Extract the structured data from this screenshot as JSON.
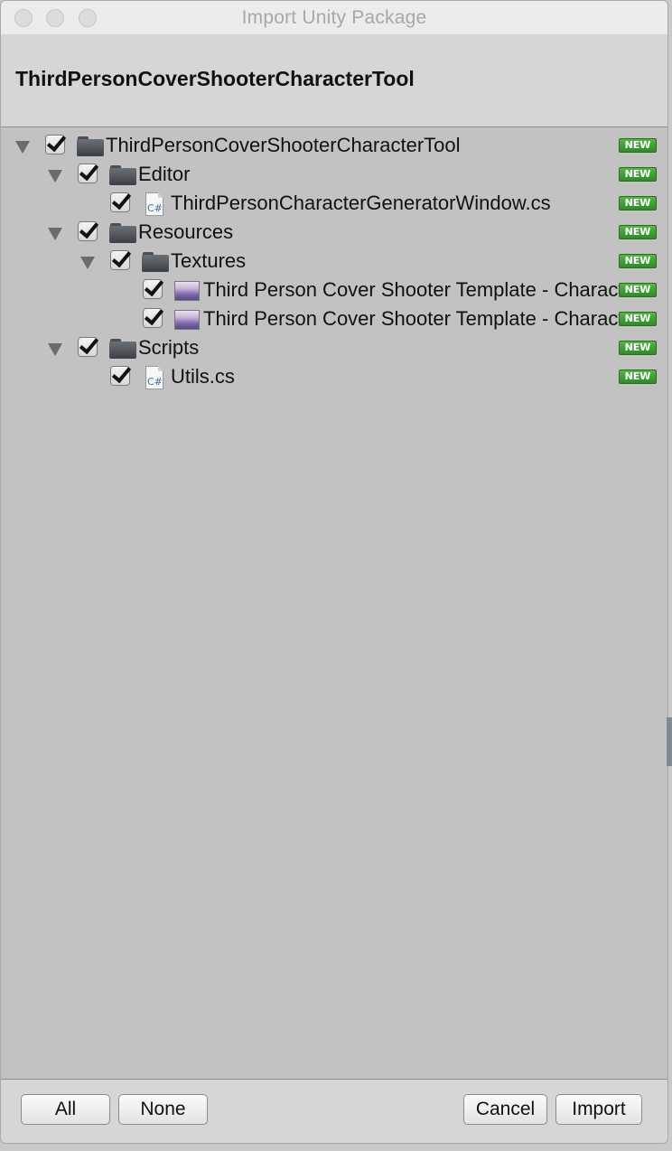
{
  "window": {
    "title": "Import Unity Package"
  },
  "header": {
    "package_name": "ThirdPersonCoverShooterCharacterTool"
  },
  "tree": {
    "badge_text": "NEW",
    "items": [
      {
        "label": "ThirdPersonCoverShooterCharacterTool",
        "type": "folder",
        "expandable": true,
        "checked": true,
        "badge": "NEW"
      },
      {
        "label": "Editor",
        "type": "folder",
        "expandable": true,
        "checked": true,
        "badge": "NEW"
      },
      {
        "label": "ThirdPersonCharacterGeneratorWindow.cs",
        "type": "cs",
        "icon_text": "C#",
        "checked": true,
        "badge": "NEW"
      },
      {
        "label": "Resources",
        "type": "folder",
        "expandable": true,
        "checked": true,
        "badge": "NEW"
      },
      {
        "label": "Textures",
        "type": "folder",
        "expandable": true,
        "checked": true,
        "badge": "NEW"
      },
      {
        "label": "Third Person Cover Shooter Template - Characte",
        "type": "texture",
        "checked": true,
        "badge": "NEW"
      },
      {
        "label": "Third Person Cover Shooter Template - Characte",
        "type": "texture",
        "checked": true,
        "badge": "NEW"
      },
      {
        "label": "Scripts",
        "type": "folder",
        "expandable": true,
        "checked": true,
        "badge": "NEW"
      },
      {
        "label": "Utils.cs",
        "type": "cs",
        "icon_text": "C#",
        "checked": true,
        "badge": "NEW"
      }
    ]
  },
  "footer": {
    "all_label": "All",
    "none_label": "None",
    "cancel_label": "Cancel",
    "import_label": "Import"
  },
  "colors": {
    "badge_green": "#3f9e36",
    "panel_bg": "#c2c2c2",
    "header_bg": "#d6d6d6"
  }
}
